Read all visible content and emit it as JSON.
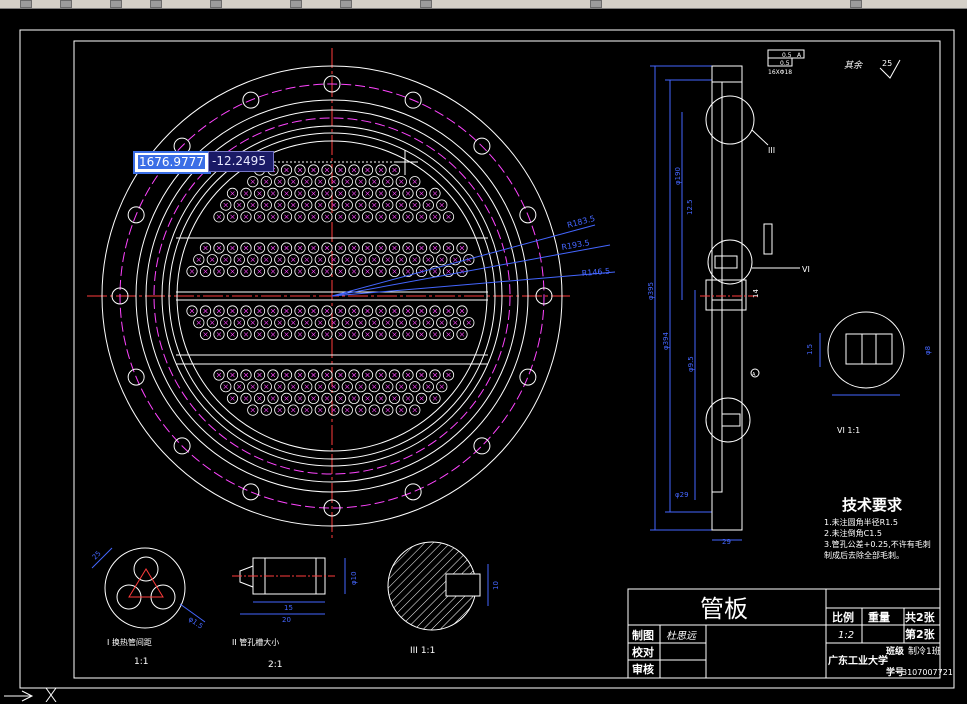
{
  "toolbar": {
    "label": "toolbar"
  },
  "coordinates": {
    "x": "1676.9777",
    "y": "-12.2495"
  },
  "drawing": {
    "dim_r1": "R183.5",
    "dim_r2": "R193.5",
    "dim_r3": "R146.5",
    "dim_phi": "φ1.5",
    "dim_vert1": "φ190",
    "dim_vert2": "12.5",
    "dim_vert3": "φ394",
    "dim_vert4": "φ395",
    "dim_vert5": "φ9.5",
    "dim_vert6": "φ29",
    "dim_bottom": "29",
    "tol_1": "0.5",
    "tol_ref_a": "A",
    "tol_2": "0.5",
    "hole_note": "16XΦ18",
    "rough_note": "其余",
    "rough_val": "25",
    "label_III": "III",
    "label_VI": "VI",
    "label_A": "A",
    "dim_14": "14",
    "dim_right": "1.5",
    "dim_h15": "15",
    "dim_hv": "φ10",
    "dim_c1": "25",
    "dim_c2": "φ1.5",
    "dim_d15": "15",
    "dim_d20": "20",
    "dim_d10": "φ10",
    "dim_iii10": "10",
    "view_I_caption": "I 换热管间距",
    "view_I_scale": "1:1",
    "view_II_caption": "II 管孔槽大小",
    "view_II_scale": "2:1",
    "view_III_caption": "III  1:1",
    "view_VI_caption": "VI   1:1",
    "vi_dim_left": "1.5",
    "vi_dim_right": "φ8"
  },
  "tech": {
    "title": "技术要求",
    "line1": "1.未注圆角半径R1.5",
    "line2": "2.未注倒角C1.5",
    "line3": "3.管孔公差+0.25,不许有毛刺",
    "line4": "制成后去除全部毛刺。"
  },
  "titleblock": {
    "name": "管板",
    "scale_label": "比例",
    "weight_label": "重量",
    "total_sheets": "共2张",
    "scale_value": "1:2",
    "sheet_no": "第2张",
    "drawn_label": "制图",
    "drawn_by": "杜思远",
    "check_label": "校对",
    "review_label": "审核",
    "school": "广东工业大学",
    "class_label": "班级",
    "class_value": "制冷1班",
    "id_label": "学号",
    "id_value": "3107007721"
  }
}
